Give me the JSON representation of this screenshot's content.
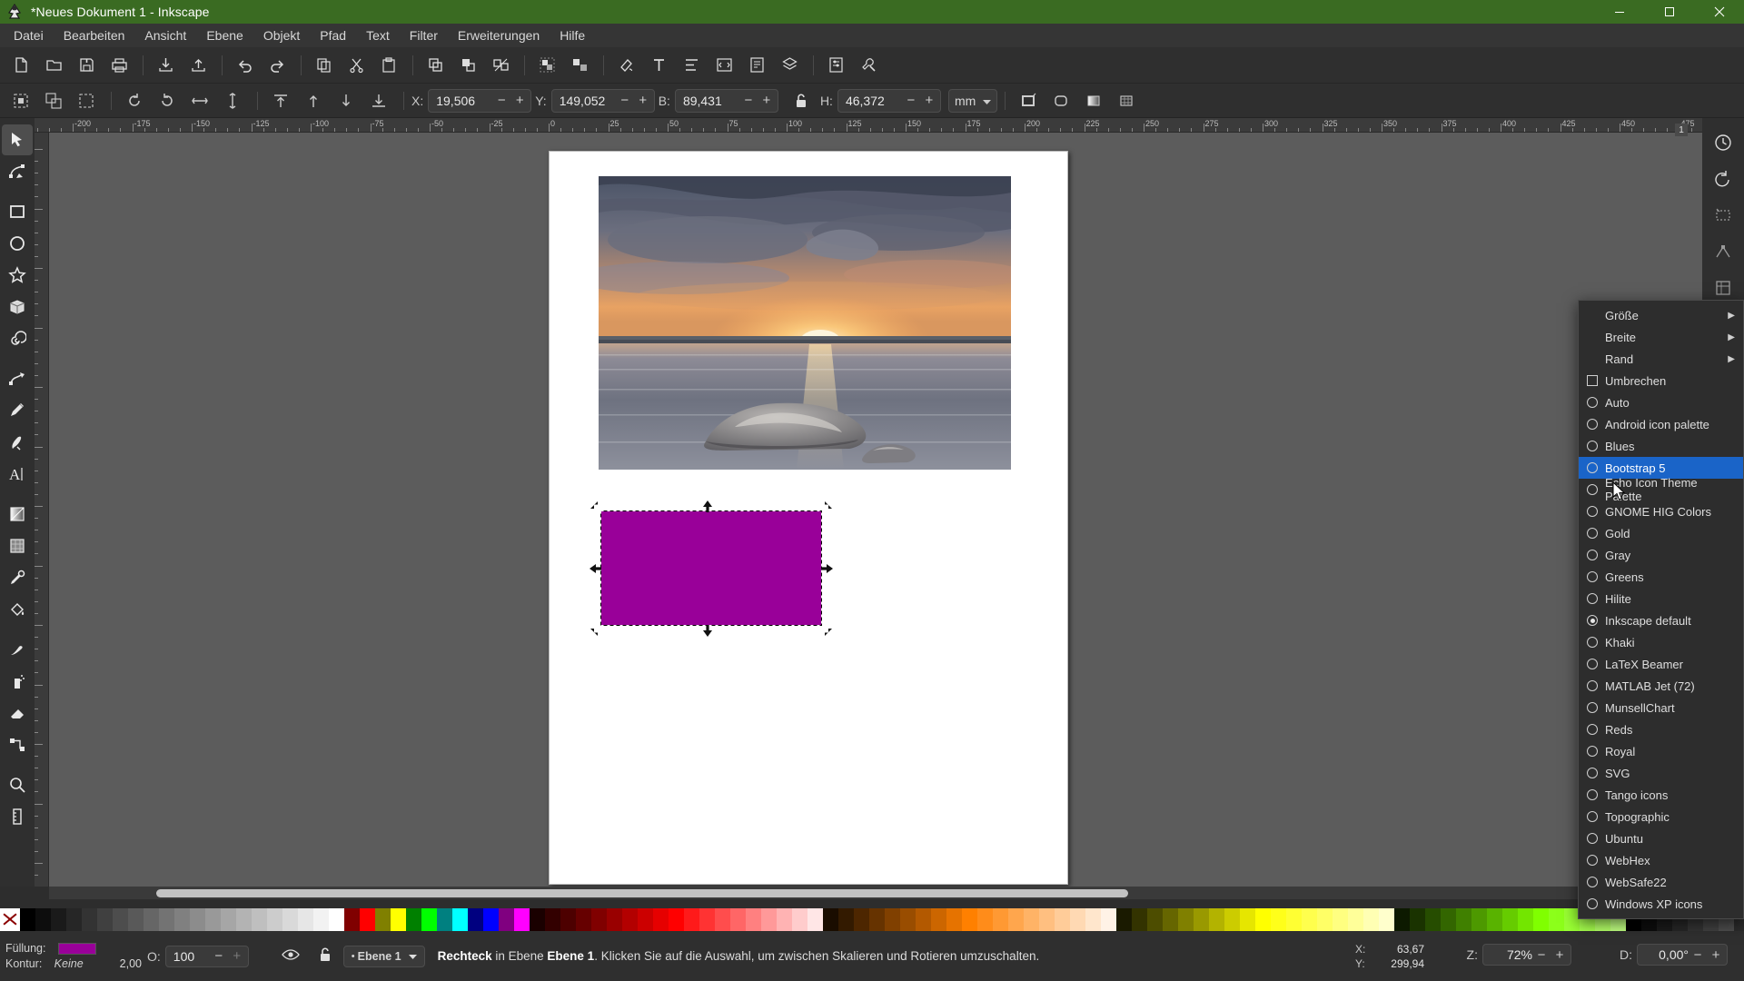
{
  "window": {
    "title": "*Neues Dokument 1 - Inkscape",
    "app_icon": "inkscape-logo-icon",
    "buttons": {
      "minimize": "–",
      "maximize": "☐",
      "close": "✕"
    },
    "titlebar_color": "#3a6b22"
  },
  "menubar": {
    "items": [
      {
        "label": "Datei"
      },
      {
        "label": "Bearbeiten"
      },
      {
        "label": "Ansicht"
      },
      {
        "label": "Ebene"
      },
      {
        "label": "Objekt"
      },
      {
        "label": "Pfad"
      },
      {
        "label": "Text"
      },
      {
        "label": "Filter"
      },
      {
        "label": "Erweiterungen"
      },
      {
        "label": "Hilfe"
      }
    ]
  },
  "command_toolbar": {
    "buttons": [
      {
        "name": "new-document-icon"
      },
      {
        "name": "open-document-icon"
      },
      {
        "name": "save-document-icon"
      },
      {
        "name": "print-document-icon"
      },
      {
        "name": "import-icon"
      },
      {
        "name": "export-icon"
      },
      {
        "name": "undo-icon"
      },
      {
        "name": "redo-icon"
      },
      {
        "name": "copy-icon"
      },
      {
        "name": "cut-icon"
      },
      {
        "name": "paste-icon"
      },
      {
        "name": "duplicate-icon"
      },
      {
        "name": "clone-icon"
      },
      {
        "name": "unlink-clone-icon"
      },
      {
        "name": "group-icon"
      },
      {
        "name": "ungroup-icon"
      },
      {
        "name": "fill-stroke-dialog-icon"
      },
      {
        "name": "text-properties-icon"
      },
      {
        "name": "align-distribute-icon"
      },
      {
        "name": "xml-editor-icon"
      },
      {
        "name": "document-properties-icon"
      },
      {
        "name": "layers-dialog-icon"
      },
      {
        "name": "preferences-icon"
      },
      {
        "name": "tool-preferences-icon"
      }
    ]
  },
  "tool_options": {
    "buttons_left": [
      {
        "name": "select-all-icon"
      },
      {
        "name": "select-all-layers-icon"
      },
      {
        "name": "deselect-icon"
      },
      {
        "name": "rotate-ccw-icon"
      },
      {
        "name": "rotate-cw-icon"
      },
      {
        "name": "flip-horizontal-icon"
      },
      {
        "name": "flip-vertical-icon"
      },
      {
        "name": "raise-to-top-icon"
      },
      {
        "name": "raise-icon"
      },
      {
        "name": "lower-icon"
      },
      {
        "name": "lower-to-bottom-icon"
      }
    ],
    "fields": [
      {
        "name": "x-field",
        "label": "X:",
        "value": "19,506"
      },
      {
        "name": "y-field",
        "label": "Y:",
        "value": "149,052"
      },
      {
        "name": "width-field",
        "label": "B:",
        "value": "89,431"
      },
      {
        "name": "height-field",
        "label": "H:",
        "value": "46,372"
      }
    ],
    "lock_ratio_icon": "unlocked-padlock-icon",
    "unit": {
      "value": "mm",
      "name": "unit-selector"
    },
    "buttons_right": [
      {
        "name": "affect-stroke-width-icon"
      },
      {
        "name": "affect-rounded-corners-icon"
      },
      {
        "name": "affect-gradients-icon"
      },
      {
        "name": "affect-patterns-icon"
      }
    ],
    "decrement": "−",
    "increment": "+"
  },
  "toolbox": {
    "tools": [
      {
        "name": "selector-tool",
        "icon": "arrow-pointer-icon",
        "active": true
      },
      {
        "name": "node-tool",
        "icon": "node-editor-icon",
        "active": false
      },
      {
        "name": "rectangle-tool",
        "icon": "square-icon",
        "active": false
      },
      {
        "name": "ellipse-tool",
        "icon": "circle-icon",
        "active": false
      },
      {
        "name": "star-tool",
        "icon": "star-icon",
        "active": false
      },
      {
        "name": "3dbox-tool",
        "icon": "cube-icon",
        "active": false
      },
      {
        "name": "spiral-tool",
        "icon": "spiral-icon",
        "active": false
      },
      {
        "name": "bezier-tool",
        "icon": "pen-path-icon",
        "active": false
      },
      {
        "name": "pencil-tool",
        "icon": "pencil-icon",
        "active": false
      },
      {
        "name": "calligraphy-tool",
        "icon": "calligraphy-pen-icon",
        "active": false
      },
      {
        "name": "text-tool",
        "icon": "text-a-icon",
        "active": false
      },
      {
        "name": "gradient-tool",
        "icon": "gradient-square-icon",
        "active": false
      },
      {
        "name": "mesh-tool",
        "icon": "mesh-gradient-icon",
        "active": false
      },
      {
        "name": "dropper-tool",
        "icon": "eyedropper-icon",
        "active": false
      },
      {
        "name": "paintbucket-tool",
        "icon": "paint-bucket-icon",
        "active": false
      },
      {
        "name": "tweak-tool",
        "icon": "tweak-icon",
        "active": false
      },
      {
        "name": "spray-tool",
        "icon": "spray-can-icon",
        "active": false
      },
      {
        "name": "eraser-tool",
        "icon": "eraser-icon",
        "active": false
      },
      {
        "name": "connector-tool",
        "icon": "connector-icon",
        "active": false
      },
      {
        "name": "zoom-tool",
        "icon": "magnifier-icon",
        "active": false
      },
      {
        "name": "measure-tool",
        "icon": "ruler-icon",
        "active": false
      }
    ]
  },
  "right_dock": {
    "buttons": [
      {
        "name": "command-palette-icon"
      },
      {
        "name": "snap-enable-icon"
      },
      {
        "name": "snap-bounding-box-icon"
      },
      {
        "name": "snap-nodes-icon"
      },
      {
        "name": "snap-page-border-icon"
      }
    ]
  },
  "canvas": {
    "page_label": "document-page",
    "objects": [
      {
        "name": "imported-photo",
        "alt": "sunset-over-lake-photograph"
      },
      {
        "name": "selected-rectangle",
        "fill": "#990099"
      }
    ],
    "ruler_h_labels": [
      "-175",
      "-150",
      "-125",
      "-100",
      "-75",
      "-50",
      "-25",
      "0",
      "25",
      "50",
      "75",
      "100",
      "125",
      "150",
      "175",
      "200",
      "225",
      "250",
      "275",
      "300",
      "325",
      "350",
      "375",
      "400",
      "425",
      "450"
    ],
    "layer_indicator": "1"
  },
  "palette_popup": {
    "name": "palette-selection-menu",
    "submenus": [
      {
        "label": "Größe",
        "has_submenu": true
      },
      {
        "label": "Breite",
        "has_submenu": true
      },
      {
        "label": "Rand",
        "has_submenu": true
      }
    ],
    "checkbox": {
      "label": "Umbrechen",
      "checked": false
    },
    "palettes": [
      {
        "label": "Auto",
        "selected": false,
        "highlight": false
      },
      {
        "label": "Android icon palette",
        "selected": false,
        "highlight": false
      },
      {
        "label": "Blues",
        "selected": false,
        "highlight": false
      },
      {
        "label": "Bootstrap 5",
        "selected": false,
        "highlight": true
      },
      {
        "label": "Echo Icon Theme Palette",
        "selected": false,
        "highlight": false
      },
      {
        "label": "GNOME HIG Colors",
        "selected": false,
        "highlight": false
      },
      {
        "label": "Gold",
        "selected": false,
        "highlight": false
      },
      {
        "label": "Gray",
        "selected": false,
        "highlight": false
      },
      {
        "label": "Greens",
        "selected": false,
        "highlight": false
      },
      {
        "label": "Hilite",
        "selected": false,
        "highlight": false
      },
      {
        "label": "Inkscape default",
        "selected": true,
        "highlight": false
      },
      {
        "label": "Khaki",
        "selected": false,
        "highlight": false
      },
      {
        "label": "LaTeX Beamer",
        "selected": false,
        "highlight": false
      },
      {
        "label": "MATLAB Jet (72)",
        "selected": false,
        "highlight": false
      },
      {
        "label": "MunsellChart",
        "selected": false,
        "highlight": false
      },
      {
        "label": "Reds",
        "selected": false,
        "highlight": false
      },
      {
        "label": "Royal",
        "selected": false,
        "highlight": false
      },
      {
        "label": "SVG",
        "selected": false,
        "highlight": false
      },
      {
        "label": "Tango icons",
        "selected": false,
        "highlight": false
      },
      {
        "label": "Topographic",
        "selected": false,
        "highlight": false
      },
      {
        "label": "Ubuntu",
        "selected": false,
        "highlight": false
      },
      {
        "label": "WebHex",
        "selected": false,
        "highlight": false
      },
      {
        "label": "WebSafe22",
        "selected": false,
        "highlight": false
      },
      {
        "label": "Windows XP icons",
        "selected": false,
        "highlight": false
      }
    ],
    "highlight_color": "#1a64c8"
  },
  "statusbar": {
    "fill_label": "Füllung:",
    "fill_color": "#990099",
    "stroke_label": "Kontur:",
    "stroke_value": "Keine",
    "stroke_width": "2,00",
    "opacity_label": "O:",
    "opacity_value": "100",
    "visibility_icon": "eye-icon",
    "lock_icon": "unlocked-padlock-icon",
    "layer_name": "Ebene 1",
    "message_object": "Rechteck",
    "message_mid": " in Ebene ",
    "message_layer": "Ebene 1",
    "message_tail": ". Klicken Sie auf die Auswahl, um zwischen Skalieren und Rotieren umzuschalten.",
    "coord_x_label": "X:",
    "coord_x_value": "63,67",
    "coord_y_label": "Y:",
    "coord_y_value": "299,94",
    "zoom_label": "Z:",
    "zoom_value": "72%",
    "rotation_label": "D:",
    "rotation_value": "0,00°",
    "minus": "−",
    "plus": "+"
  },
  "palette_strip": {
    "name": "color-palette-strip",
    "none_swatch": "no-color-icon",
    "colors": [
      "#000000",
      "#0d0d0d",
      "#1a1a1a",
      "#262626",
      "#333333",
      "#404040",
      "#4d4d4d",
      "#595959",
      "#666666",
      "#737373",
      "#808080",
      "#8c8c8c",
      "#999999",
      "#a6a6a6",
      "#b3b3b3",
      "#bfbfbf",
      "#cccccc",
      "#d9d9d9",
      "#e6e6e6",
      "#f2f2f2",
      "#ffffff",
      "#800000",
      "#ff0000",
      "#808000",
      "#ffff00",
      "#008000",
      "#00ff00",
      "#008080",
      "#00ffff",
      "#000080",
      "#0000ff",
      "#800080",
      "#ff00ff",
      "#1a0000",
      "#330000",
      "#4d0000",
      "#660000",
      "#800000",
      "#990000",
      "#b30000",
      "#cc0000",
      "#e60000",
      "#ff0000",
      "#ff1a1a",
      "#ff3333",
      "#ff4d4d",
      "#ff6666",
      "#ff8080",
      "#ff9999",
      "#ffb3b3",
      "#ffcccc",
      "#ffe6e6",
      "#1a0d00",
      "#331a00",
      "#4d2600",
      "#663300",
      "#804000",
      "#994d00",
      "#b35900",
      "#cc6600",
      "#e67300",
      "#ff8000",
      "#ff8c1a",
      "#ff9933",
      "#ffa64d",
      "#ffb366",
      "#ffbf80",
      "#ffcc99",
      "#ffd9b3",
      "#ffe6cc",
      "#fff2e6",
      "#1a1a00",
      "#333300",
      "#4d4d00",
      "#666600",
      "#808000",
      "#999900",
      "#b3b300",
      "#cccc00",
      "#e6e600",
      "#ffff00",
      "#ffff1a",
      "#ffff33",
      "#ffff4d",
      "#ffff66",
      "#ffff80",
      "#ffff99",
      "#ffffb3",
      "#ffffcc",
      "#0d1a00",
      "#1a3300",
      "#264d00",
      "#336600",
      "#408000",
      "#4d9900",
      "#59b300",
      "#66cc00",
      "#73e600",
      "#80ff00",
      "#8cff1a",
      "#99ff33",
      "#a6ff4d",
      "#b3ff66",
      "#bfff80"
    ]
  }
}
